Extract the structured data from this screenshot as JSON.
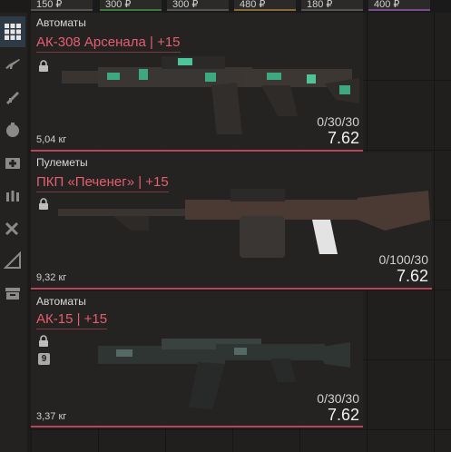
{
  "price_strip": [
    "150 ₽",
    "300 ₽",
    "300 ₽",
    "480 ₽",
    "180 ₽",
    "400 ₽"
  ],
  "sidebar": {
    "items": [
      {
        "icon": "grid-icon",
        "active": true
      },
      {
        "icon": "assault-rifle-icon"
      },
      {
        "icon": "rocket-launcher-icon"
      },
      {
        "icon": "grenade-icon"
      },
      {
        "icon": "medkit-icon"
      },
      {
        "icon": "ammo-icon"
      },
      {
        "icon": "tools-icon"
      },
      {
        "icon": "ruler-icon"
      },
      {
        "icon": "crate-icon"
      }
    ]
  },
  "items": [
    {
      "category": "Автоматы",
      "name": "АК-308 Арсенала | +15",
      "weight": "5,04 кг",
      "ammo": "0/30/30",
      "caliber": "7.62",
      "locked": true
    },
    {
      "category": "Пулеметы",
      "name": "ПКП «Печенег» | +15",
      "weight": "9,32 кг",
      "ammo": "0/100/30",
      "caliber": "7.62",
      "locked": true
    },
    {
      "category": "Автоматы",
      "name": "АК-15 | +15",
      "weight": "3,37 кг",
      "ammo": "0/30/30",
      "caliber": "7.62",
      "locked": true,
      "badge": "9"
    }
  ],
  "colors": {
    "rarity_accent": "#b8455a",
    "name_text": "#e85d70",
    "active_category": "#2e3a45"
  }
}
